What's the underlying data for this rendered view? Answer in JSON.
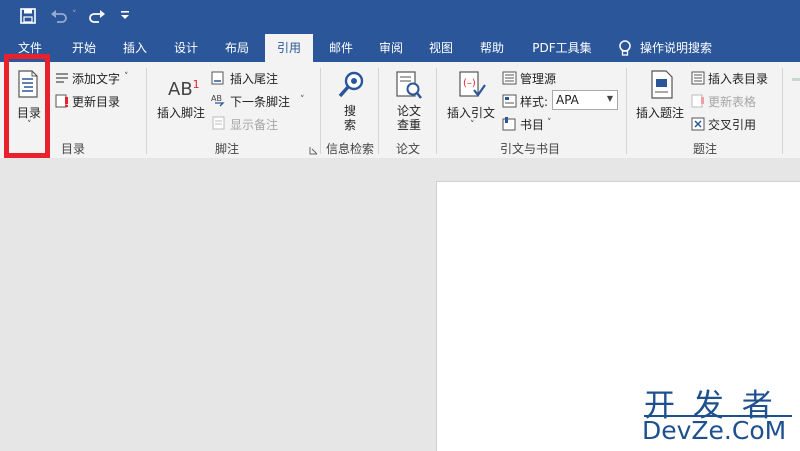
{
  "qat": {
    "save": "save-icon",
    "undo": "undo-icon",
    "redo": "redo-icon",
    "customize": "customize-icon"
  },
  "tabs": [
    {
      "label": "文件"
    },
    {
      "label": "开始"
    },
    {
      "label": "插入"
    },
    {
      "label": "设计"
    },
    {
      "label": "布局"
    },
    {
      "label": "引用"
    },
    {
      "label": "邮件"
    },
    {
      "label": "审阅"
    },
    {
      "label": "视图"
    },
    {
      "label": "帮助"
    },
    {
      "label": "PDF工具集"
    }
  ],
  "tell_me": "操作说明搜索",
  "ribbon": {
    "toc": {
      "button": "目录",
      "add_text": "添加文字",
      "update_table": "更新目录",
      "group": "目录"
    },
    "footnotes": {
      "insert_footnote": "插入脚注",
      "insert_endnote": "插入尾注",
      "next_footnote": "下一条脚注",
      "show_notes": "显示备注",
      "group": "脚注",
      "ab_glyph": "AB",
      "ab_sup": "1"
    },
    "research": {
      "search": "搜索",
      "group": "信息检索"
    },
    "thesis": {
      "check": "论文查重",
      "group": "论文"
    },
    "citations": {
      "insert_citation": "插入引文",
      "manage_sources": "管理源",
      "style_label": "样式:",
      "style_value": "APA",
      "bibliography": "书目",
      "group": "引文与书目"
    },
    "captions": {
      "insert_caption": "插入题注",
      "insert_tof": "插入表目录",
      "update_table": "更新表格",
      "cross_ref": "交叉引用",
      "group": "题注"
    }
  },
  "watermark": {
    "line1": "开 发 者",
    "line2": "DevZe.CoM"
  },
  "colors": {
    "accent": "#2b579a",
    "highlight": "#e8212d"
  }
}
